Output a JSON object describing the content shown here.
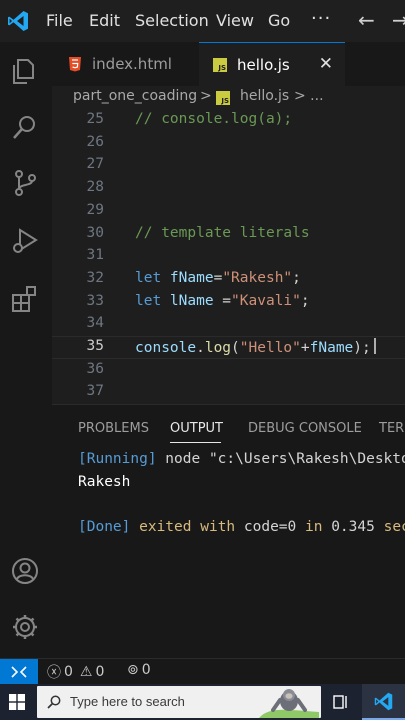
{
  "menu": [
    "File",
    "Edit",
    "Selection",
    "View",
    "Go"
  ],
  "menu_more": "···",
  "nav": {
    "back": "←",
    "forward": "→"
  },
  "tabs": [
    {
      "label": "index.html",
      "icon": "html5-icon",
      "active": false
    },
    {
      "label": "hello.js",
      "icon": "js-file-icon",
      "active": true
    }
  ],
  "tab_close": "✕",
  "js_icon_text": "JS",
  "breadcrumb": {
    "folder": "part_one_coading",
    "sep": ">",
    "file": "hello.js",
    "more": "> ..."
  },
  "editor": {
    "lines": [
      {
        "n": "25",
        "code": [
          {
            "t": "// console.log(a);",
            "c": "comment"
          }
        ]
      },
      {
        "n": "26",
        "code": []
      },
      {
        "n": "27",
        "code": []
      },
      {
        "n": "28",
        "code": []
      },
      {
        "n": "29",
        "code": []
      },
      {
        "n": "30",
        "code": [
          {
            "t": "// template literals",
            "c": "comment"
          }
        ]
      },
      {
        "n": "31",
        "code": []
      },
      {
        "n": "32",
        "code": [
          {
            "t": "let ",
            "c": "kw"
          },
          {
            "t": "fName",
            "c": "var"
          },
          {
            "t": "=",
            "c": "plain"
          },
          {
            "t": "\"Rakesh\"",
            "c": "str"
          },
          {
            "t": ";",
            "c": "plain"
          }
        ]
      },
      {
        "n": "33",
        "code": [
          {
            "t": "let ",
            "c": "kw"
          },
          {
            "t": "lName",
            "c": "var"
          },
          {
            "t": " =",
            "c": "plain"
          },
          {
            "t": "\"Kavali\"",
            "c": "str"
          },
          {
            "t": ";",
            "c": "plain"
          }
        ]
      },
      {
        "n": "34",
        "code": []
      },
      {
        "n": "35",
        "code": [
          {
            "t": "console",
            "c": "var"
          },
          {
            "t": ".",
            "c": "plain"
          },
          {
            "t": "log",
            "c": "fn"
          },
          {
            "t": "(",
            "c": "plain"
          },
          {
            "t": "\"Hello\"",
            "c": "str"
          },
          {
            "t": "+",
            "c": "plain"
          },
          {
            "t": "fName",
            "c": "var"
          },
          {
            "t": ");",
            "c": "plain"
          }
        ],
        "current": true
      },
      {
        "n": "36",
        "code": []
      },
      {
        "n": "37",
        "code": []
      }
    ]
  },
  "panel": {
    "tabs": [
      "PROBLEMS",
      "OUTPUT",
      "DEBUG CONSOLE",
      "TERMINAL"
    ],
    "active_tab": "OUTPUT",
    "output": {
      "running_tag": "[Running]",
      "running_cmd": " node \"c:\\Users\\Rakesh\\Desktop\\part_one_coading\\hello.js\"",
      "result": "Rakesh",
      "done_tag": "[Done]",
      "done_text1": " exited with ",
      "done_code": "code=0",
      "done_text2": " in ",
      "done_time": "0.345",
      "done_text3": " seconds"
    }
  },
  "status": {
    "errors": "0",
    "warnings": "0",
    "ports": "0"
  },
  "taskbar": {
    "search_placeholder": "Type here to search"
  },
  "colors": {
    "accent": "#0078d4",
    "statusbar_remote": "#0078d4",
    "js_yellow": "#cbcb41",
    "html_orange": "#e44d26"
  }
}
